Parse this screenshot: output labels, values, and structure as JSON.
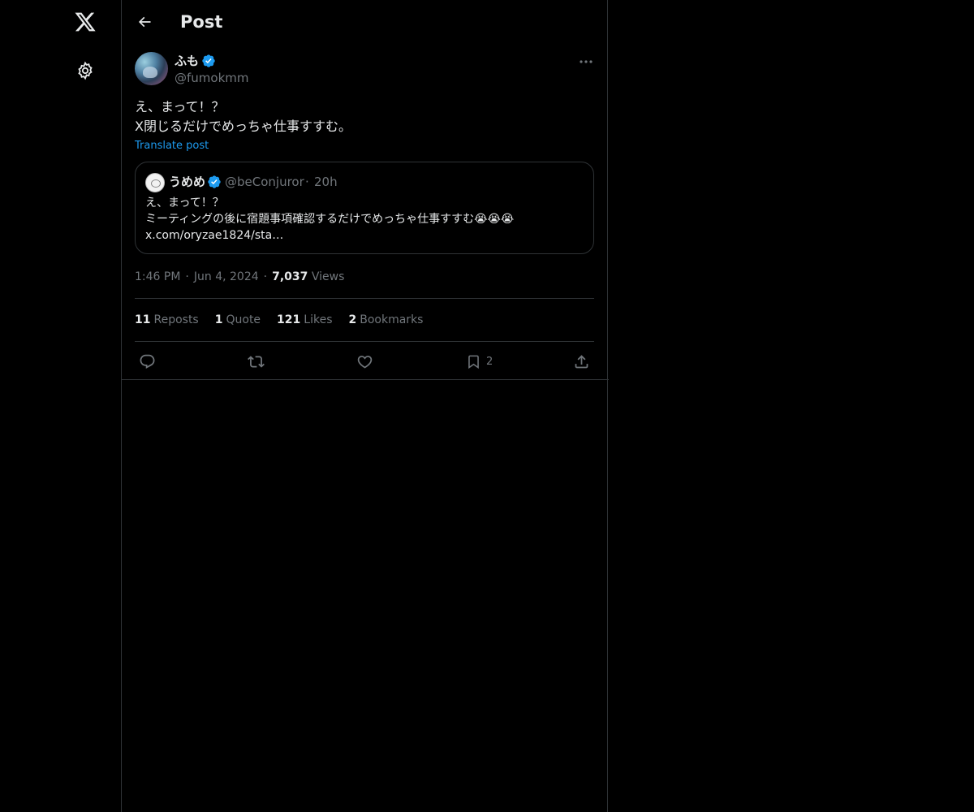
{
  "header": {
    "title": "Post"
  },
  "post": {
    "author_name": "ふも",
    "author_handle": "@fumokmm",
    "text_lines": [
      "え、まって！？",
      "X閉じるだけでめっちゃ仕事すすむ。"
    ],
    "translate_label": "Translate post",
    "quote": {
      "name": "うめめ",
      "handle": "@beConjuror",
      "separator": "·",
      "time": "20h",
      "text_lines": [
        "え、まって！？",
        "ミーティングの後に宿題事項確認するだけでめっちゃ仕事すすむ😭😭😭",
        "x.com/oryzae1824/sta…"
      ]
    },
    "time": "1:46 PM",
    "date": "Jun 4, 2024",
    "separator": "·",
    "views_count": "7,037",
    "views_label": "Views",
    "stats": {
      "reposts_count": "11",
      "reposts_label": "Reposts",
      "quotes_count": "1",
      "quotes_label": "Quote",
      "likes_count": "121",
      "likes_label": "Likes",
      "bookmarks_count": "2",
      "bookmarks_label": "Bookmarks"
    },
    "actions": {
      "bookmark_count": "2"
    }
  },
  "icons": {
    "logo": "x-logo-icon",
    "settings": "gear-icon",
    "back": "arrow-left-icon",
    "more": "more-horizontal-icon",
    "verified": "verified-badge-icon",
    "reply": "reply-icon",
    "repost": "repost-icon",
    "like": "heart-icon",
    "bookmark": "bookmark-icon",
    "share": "share-icon"
  },
  "colors": {
    "background": "#000000",
    "text": "#e7e9ea",
    "secondary": "#71767b",
    "accent": "#1d9bf0",
    "border": "#2f3336"
  }
}
